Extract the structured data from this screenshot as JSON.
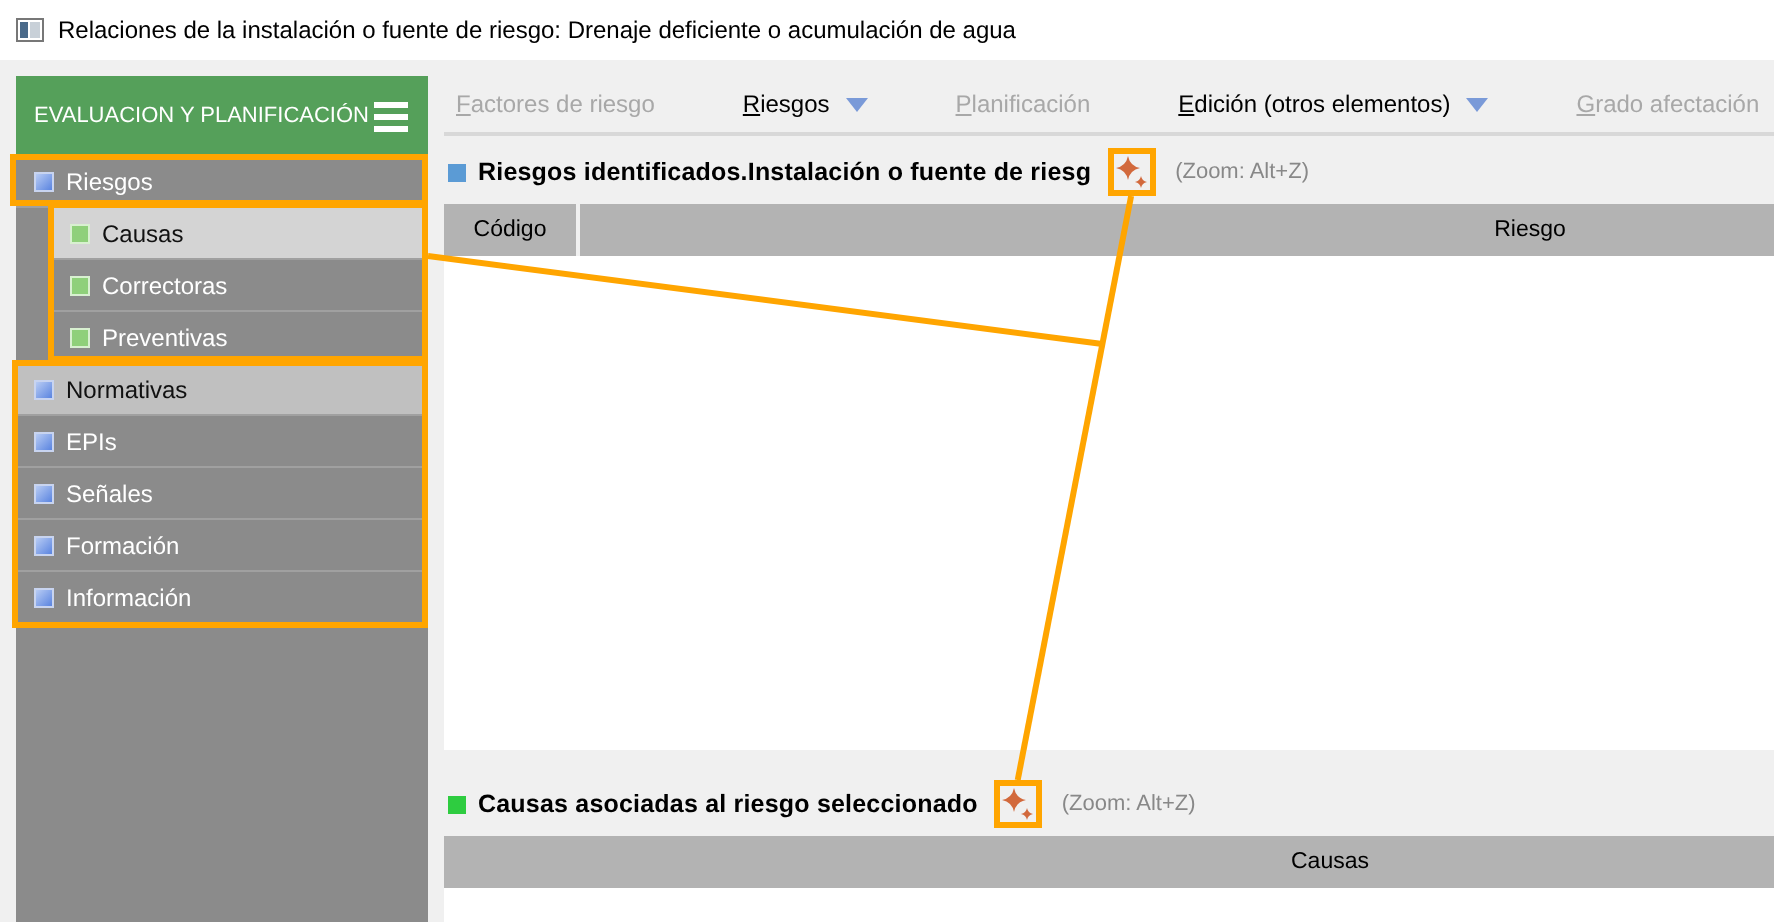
{
  "window": {
    "title": "Relaciones de la instalación o fuente de riesgo: Drenaje deficiente o acumulación de agua"
  },
  "sidebar": {
    "title": "EVALUACION Y PLANIFICACIÓN",
    "items": [
      {
        "label": "Riesgos",
        "selected": false,
        "children": [
          {
            "label": "Causas",
            "selected": true
          },
          {
            "label": "Correctoras",
            "selected": false
          },
          {
            "label": "Preventivas",
            "selected": false
          }
        ]
      },
      {
        "label": "Normativas",
        "selected": true
      },
      {
        "label": "EPIs",
        "selected": false
      },
      {
        "label": "Señales",
        "selected": false
      },
      {
        "label": "Formación",
        "selected": false
      },
      {
        "label": "Información",
        "selected": false
      }
    ]
  },
  "toolbar": [
    {
      "label": "Factores de riesgo",
      "disabled": true,
      "dropdown": false
    },
    {
      "label": "Riesgos",
      "disabled": false,
      "dropdown": true
    },
    {
      "label": "Planificación",
      "disabled": true,
      "dropdown": false
    },
    {
      "label": "Edición (otros elementos)",
      "disabled": false,
      "dropdown": true
    },
    {
      "label": "Grado afectación",
      "disabled": true,
      "dropdown": false
    }
  ],
  "panels": [
    {
      "title": "Riesgos identificados.Instalación o fuente de riesg",
      "color": "#5b9bd5",
      "hint": "(Zoom: Alt+Z)",
      "columns": [
        "Código",
        "Riesgo"
      ]
    },
    {
      "title": "Causas asociadas al riesgo seleccionado",
      "color": "#2ecc40",
      "hint": "(Zoom: Alt+Z)",
      "columns": [
        "Causas"
      ]
    }
  ]
}
